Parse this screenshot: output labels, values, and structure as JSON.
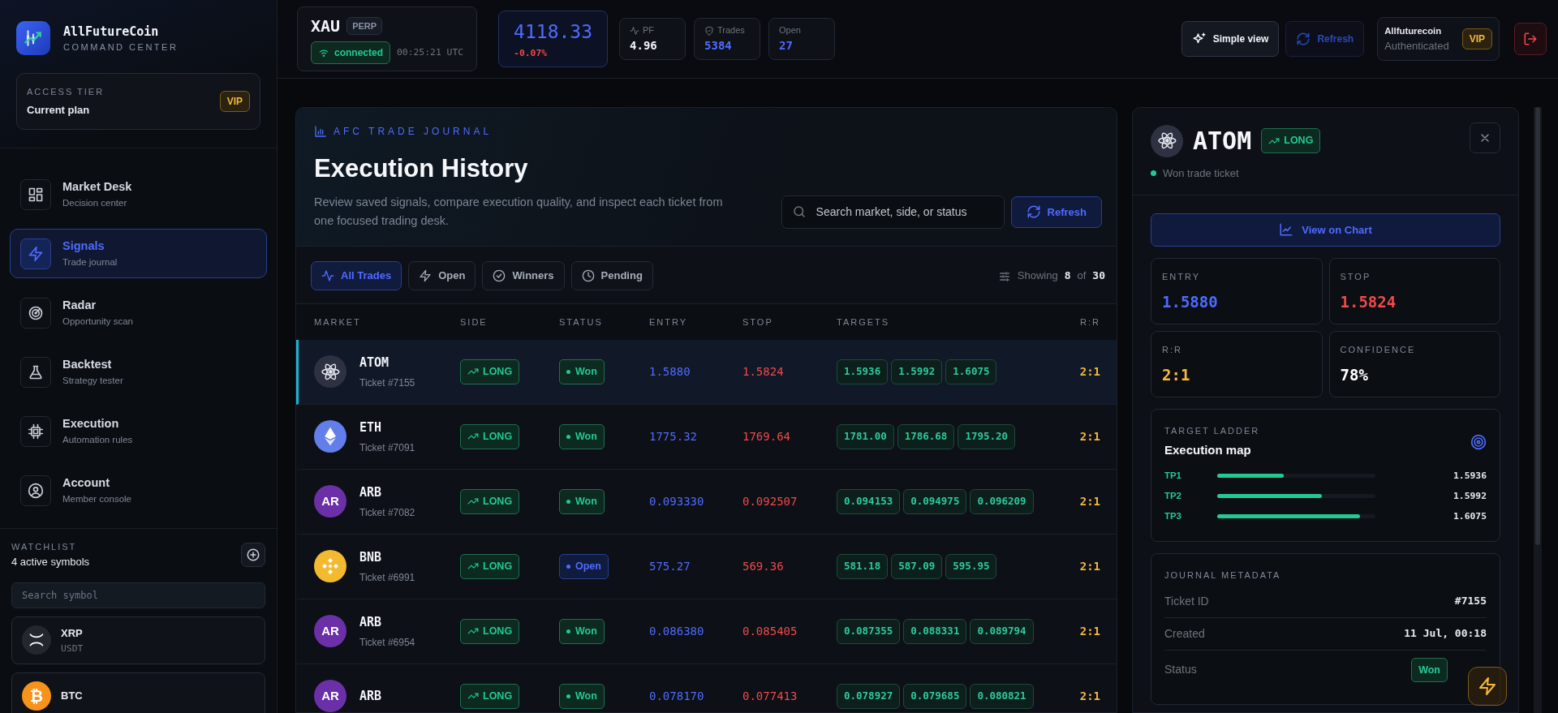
{
  "brand": {
    "name": "AllFutureCoin",
    "tagline": "COMMAND CENTER"
  },
  "access": {
    "label": "ACCESS TIER",
    "plan": "Current plan",
    "badge": "VIP"
  },
  "nav": [
    {
      "label": "Market Desk",
      "sub": "Decision center",
      "kind": "grid",
      "selected": false
    },
    {
      "label": "Signals",
      "sub": "Trade journal",
      "kind": "bolt",
      "selected": true
    },
    {
      "label": "Radar",
      "sub": "Opportunity scan",
      "kind": "radar",
      "selected": false
    },
    {
      "label": "Backtest",
      "sub": "Strategy tester",
      "kind": "flask",
      "selected": false
    },
    {
      "label": "Execution",
      "sub": "Automation rules",
      "kind": "chip",
      "selected": false
    },
    {
      "label": "Account",
      "sub": "Member console",
      "kind": "user",
      "selected": false
    }
  ],
  "watchlist": {
    "title": "WATCHLIST",
    "count": "4 active symbols",
    "search_placeholder": "Search symbol",
    "items": [
      {
        "symbol": "XRP",
        "quote": "USDT",
        "kind": "xrp",
        "color": "#24272e"
      },
      {
        "symbol": "BTC",
        "kind": "text",
        "logo_text": "₿",
        "color": "#f7931a"
      }
    ]
  },
  "topbar": {
    "symbol": "XAU",
    "tag": "PERP",
    "connection": {
      "label": "connected",
      "connected": true
    },
    "time": "00:25:21 UTC",
    "price": "4118.33",
    "change": "-0.07%",
    "stats": [
      {
        "label": "PF",
        "value": "4.96",
        "kind": "pulse",
        "color": "#f2f4f8"
      },
      {
        "label": "Trades",
        "value": "5384",
        "kind": "shield",
        "color": "#4f6bff"
      },
      {
        "label": "Open",
        "value": "27",
        "kind": "plain",
        "color": "#4f6bff"
      }
    ],
    "simple_view": "Simple view",
    "refresh": {
      "label": "Refresh",
      "disabled": true
    },
    "user": {
      "name": "Allfuturecoin",
      "status": "Authenticated",
      "badge": "VIP"
    }
  },
  "journal": {
    "eyebrow": "AFC TRADE JOURNAL",
    "title": "Execution History",
    "description": "Review saved signals, compare execution quality, and inspect each ticket from one focused trading desk.",
    "search_placeholder": "Search market, side, or status",
    "refresh": "Refresh",
    "filters": [
      {
        "label": "All Trades",
        "kind": "pulse",
        "selected": true
      },
      {
        "label": "Open",
        "kind": "bolt",
        "selected": false
      },
      {
        "label": "Winners",
        "kind": "check",
        "selected": false
      },
      {
        "label": "Pending",
        "kind": "clock",
        "selected": false
      }
    ],
    "showing": {
      "prefix": "Showing",
      "shown": "8",
      "of": "of",
      "total": "30"
    },
    "columns": [
      "MARKET",
      "SIDE",
      "STATUS",
      "ENTRY",
      "STOP",
      "TARGETS",
      "R:R"
    ],
    "rows": [
      {
        "symbol": "ATOM",
        "ticket": "Ticket #7155",
        "kind": "atom",
        "color": "#2e3142",
        "side": "LONG",
        "status": {
          "label": "Won",
          "kind": "won"
        },
        "entry": "1.5880",
        "stop": "1.5824",
        "targets": [
          "1.5936",
          "1.5992",
          "1.6075"
        ],
        "rr": "2:1",
        "selected": true
      },
      {
        "symbol": "ETH",
        "ticket": "Ticket #7091",
        "kind": "eth",
        "color": "#627eea",
        "side": "LONG",
        "status": {
          "label": "Won",
          "kind": "won"
        },
        "entry": "1775.32",
        "stop": "1769.64",
        "targets": [
          "1781.00",
          "1786.68",
          "1795.20"
        ],
        "rr": "2:1",
        "selected": false
      },
      {
        "symbol": "ARB",
        "ticket": "Ticket #7082",
        "kind": "text",
        "logo_text": "AR",
        "color": "#6b2fa8",
        "side": "LONG",
        "status": {
          "label": "Won",
          "kind": "won"
        },
        "entry": "0.093330",
        "stop": "0.092507",
        "targets": [
          "0.094153",
          "0.094975",
          "0.096209"
        ],
        "rr": "2:1",
        "selected": false
      },
      {
        "symbol": "BNB",
        "ticket": "Ticket #6991",
        "kind": "bnb",
        "color": "#f3ba2f",
        "side": "LONG",
        "status": {
          "label": "Open",
          "kind": "open"
        },
        "entry": "575.27",
        "stop": "569.36",
        "targets": [
          "581.18",
          "587.09",
          "595.95"
        ],
        "rr": "2:1",
        "selected": false
      },
      {
        "symbol": "ARB",
        "ticket": "Ticket #6954",
        "kind": "text",
        "logo_text": "AR",
        "color": "#6b2fa8",
        "side": "LONG",
        "status": {
          "label": "Won",
          "kind": "won"
        },
        "entry": "0.086380",
        "stop": "0.085405",
        "targets": [
          "0.087355",
          "0.088331",
          "0.089794"
        ],
        "rr": "2:1",
        "selected": false
      },
      {
        "symbol": "ARB",
        "kind": "text",
        "logo_text": "AR",
        "color": "#6b2fa8",
        "side": "LONG",
        "status": {
          "label": "Won",
          "kind": "won"
        },
        "entry": "0.078170",
        "stop": "0.077413",
        "targets": [
          "0.078927",
          "0.079685",
          "0.080821"
        ],
        "rr": "2:1",
        "selected": false
      }
    ]
  },
  "detail": {
    "symbol": "ATOM",
    "kind": "atom",
    "color": "#2e3142",
    "side": "LONG",
    "status": {
      "text": "Won trade ticket",
      "kind": "won"
    },
    "view_chart": "View on Chart",
    "metrics": [
      {
        "label": "ENTRY",
        "value": "1.5880",
        "kind": "entry"
      },
      {
        "label": "STOP",
        "value": "1.5824",
        "kind": "stop"
      },
      {
        "label": "R:R",
        "value": "2:1",
        "kind": "ratio"
      },
      {
        "label": "CONFIDENCE",
        "value": "78%",
        "kind": "plain"
      }
    ],
    "ladder": {
      "eyebrow": "TARGET LADDER",
      "title": "Execution map",
      "targets": [
        {
          "label": "TP1",
          "value": "1.5936",
          "level": 0.42
        },
        {
          "label": "TP2",
          "value": "1.5992",
          "level": 0.66
        },
        {
          "label": "TP3",
          "value": "1.6075",
          "level": 0.9
        }
      ]
    },
    "metadata": {
      "title": "JOURNAL METADATA",
      "rows": [
        {
          "label": "Ticket ID",
          "value": "#7155",
          "kind": "text"
        },
        {
          "label": "Created",
          "value": "11 Jul, 00:18",
          "kind": "text"
        },
        {
          "label": "Status",
          "value": "Won",
          "kind": "badge"
        }
      ]
    }
  }
}
